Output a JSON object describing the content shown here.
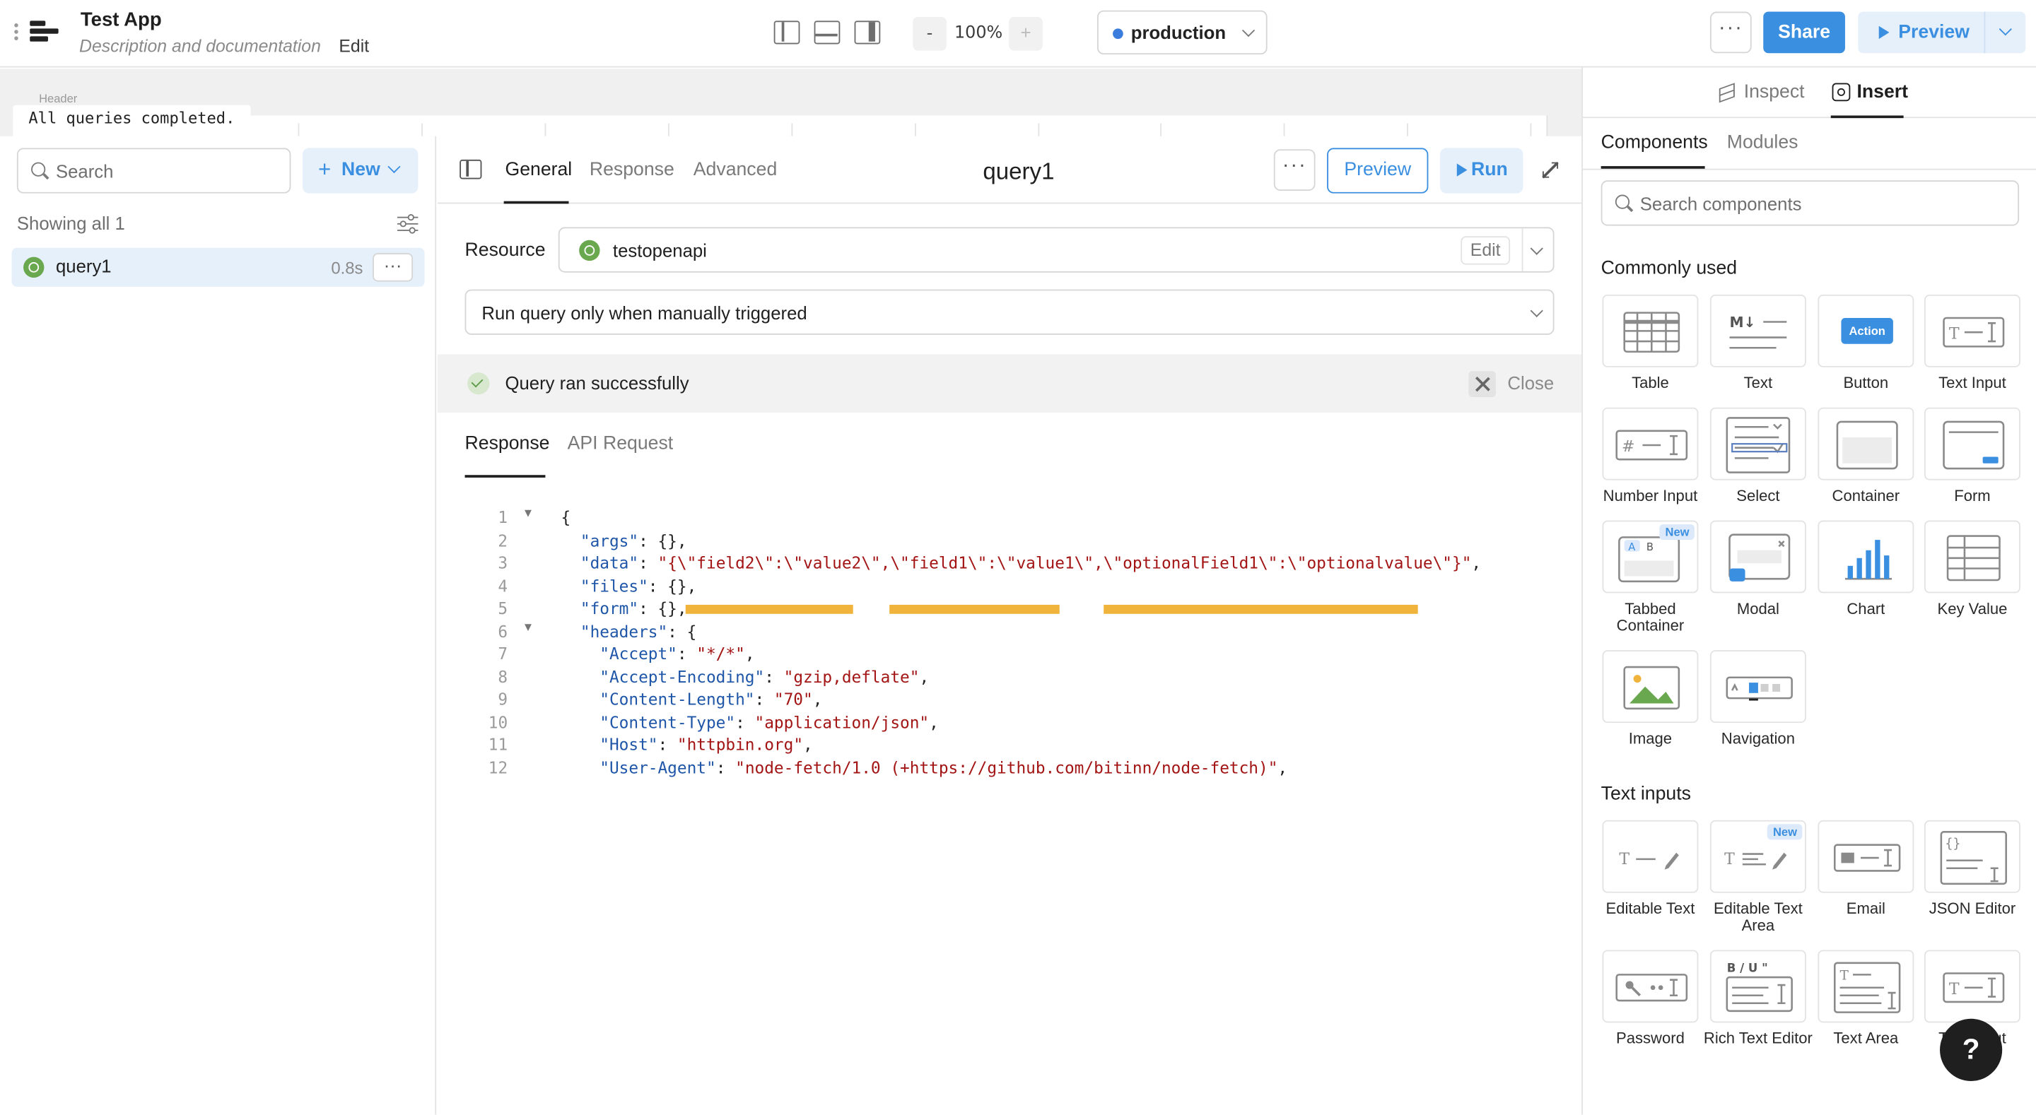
{
  "app": {
    "title": "Test App",
    "description": "Description and documentation",
    "edit_label": "Edit"
  },
  "toolbar": {
    "zoom_minus": "-",
    "zoom": "100%",
    "zoom_plus": "+",
    "environment": "production",
    "more": "···",
    "share": "Share",
    "preview": "Preview"
  },
  "canvas": {
    "header_tag": "Header",
    "toast": "All queries completed."
  },
  "query_list": {
    "search_placeholder": "Search",
    "new_label": "New",
    "showing": "Showing all 1",
    "items": [
      {
        "name": "query1",
        "time": "0.8s",
        "more": "···"
      }
    ]
  },
  "editor": {
    "tabs": [
      "General",
      "Response",
      "Advanced"
    ],
    "active_tab": "General",
    "query_name": "query1",
    "more": "···",
    "preview": "Preview",
    "run": "Run",
    "resource_label": "Resource",
    "resource": "testopenapi",
    "resource_edit": "Edit",
    "trigger": "Run query only when manually triggered",
    "status": "Query ran successfully",
    "close": "Close",
    "response_tabs": [
      "Response",
      "API Request"
    ],
    "active_response_tab": "Response"
  },
  "response_json": [
    {
      "ln": "1",
      "fold": true,
      "parts": [
        [
          "p",
          "{"
        ]
      ]
    },
    {
      "ln": "2",
      "fold": false,
      "parts": [
        [
          "p",
          "  "
        ],
        [
          "k",
          "\"args\""
        ],
        [
          "p",
          ": {},"
        ]
      ]
    },
    {
      "ln": "3",
      "fold": false,
      "parts": [
        [
          "p",
          "  "
        ],
        [
          "k",
          "\"data\""
        ],
        [
          "p",
          ": "
        ],
        [
          "s",
          "\"{\\\"field2\\\":\\\"value2\\\",\\\"field1\\\":\\\"value1\\\",\\\"optionalField1\\\":\\\"optionalvalue\\\"}\""
        ],
        [
          "p",
          ","
        ]
      ]
    },
    {
      "ln": "4",
      "fold": false,
      "parts": [
        [
          "p",
          "  "
        ],
        [
          "k",
          "\"files\""
        ],
        [
          "p",
          ": {},"
        ]
      ]
    },
    {
      "ln": "5",
      "fold": false,
      "parts": [
        [
          "p",
          "  "
        ],
        [
          "k",
          "\"form\""
        ],
        [
          "p",
          ": {},"
        ]
      ]
    },
    {
      "ln": "6",
      "fold": true,
      "parts": [
        [
          "p",
          "  "
        ],
        [
          "k",
          "\"headers\""
        ],
        [
          "p",
          ": {"
        ]
      ]
    },
    {
      "ln": "7",
      "fold": false,
      "parts": [
        [
          "p",
          "    "
        ],
        [
          "k",
          "\"Accept\""
        ],
        [
          "p",
          ": "
        ],
        [
          "s",
          "\"*/*\""
        ],
        [
          "p",
          ","
        ]
      ]
    },
    {
      "ln": "8",
      "fold": false,
      "parts": [
        [
          "p",
          "    "
        ],
        [
          "k",
          "\"Accept-Encoding\""
        ],
        [
          "p",
          ": "
        ],
        [
          "s",
          "\"gzip,deflate\""
        ],
        [
          "p",
          ","
        ]
      ]
    },
    {
      "ln": "9",
      "fold": false,
      "parts": [
        [
          "p",
          "    "
        ],
        [
          "k",
          "\"Content-Length\""
        ],
        [
          "p",
          ": "
        ],
        [
          "s",
          "\"70\""
        ],
        [
          "p",
          ","
        ]
      ]
    },
    {
      "ln": "10",
      "fold": false,
      "parts": [
        [
          "p",
          "    "
        ],
        [
          "k",
          "\"Content-Type\""
        ],
        [
          "p",
          ": "
        ],
        [
          "s",
          "\"application/json\""
        ],
        [
          "p",
          ","
        ]
      ]
    },
    {
      "ln": "11",
      "fold": false,
      "parts": [
        [
          "p",
          "    "
        ],
        [
          "k",
          "\"Host\""
        ],
        [
          "p",
          ": "
        ],
        [
          "s",
          "\"httpbin.org\""
        ],
        [
          "p",
          ","
        ]
      ]
    },
    {
      "ln": "12",
      "fold": false,
      "parts": [
        [
          "p",
          "    "
        ],
        [
          "k",
          "\"User-Agent\""
        ],
        [
          "p",
          ": "
        ],
        [
          "s",
          "\"node-fetch/1.0 (+https://github.com/bitinn/node-fetch)\""
        ],
        [
          "p",
          ","
        ]
      ]
    }
  ],
  "right_panel": {
    "tabs": [
      "Inspect",
      "Insert"
    ],
    "active_tab": "Insert",
    "subtabs": [
      "Components",
      "Modules"
    ],
    "active_subtab": "Components",
    "search_placeholder": "Search components",
    "sections": [
      {
        "title": "Commonly used",
        "components": [
          {
            "label": "Table",
            "icon": "table-icon"
          },
          {
            "label": "Text",
            "icon": "markdown-text-icon"
          },
          {
            "label": "Button",
            "icon": "action-button-icon",
            "badge": "Action"
          },
          {
            "label": "Text Input",
            "icon": "text-input-icon"
          },
          {
            "label": "Number Input",
            "icon": "number-input-icon"
          },
          {
            "label": "Select",
            "icon": "select-icon"
          },
          {
            "label": "Container",
            "icon": "container-icon"
          },
          {
            "label": "Form",
            "icon": "form-icon"
          },
          {
            "label": "Tabbed Container",
            "icon": "tabbed-container-icon",
            "new": "New"
          },
          {
            "label": "Modal",
            "icon": "modal-icon"
          },
          {
            "label": "Chart",
            "icon": "chart-icon"
          },
          {
            "label": "Key Value",
            "icon": "key-value-icon"
          },
          {
            "label": "Image",
            "icon": "image-icon"
          },
          {
            "label": "Navigation",
            "icon": "navigation-icon"
          }
        ]
      },
      {
        "title": "Text inputs",
        "components": [
          {
            "label": "Editable Text",
            "icon": "editable-text-icon"
          },
          {
            "label": "Editable Text Area",
            "icon": "editable-text-area-icon",
            "new": "New"
          },
          {
            "label": "Email",
            "icon": "email-icon"
          },
          {
            "label": "JSON Editor",
            "icon": "json-editor-icon"
          },
          {
            "label": "Password",
            "icon": "password-icon"
          },
          {
            "label": "Rich Text Editor",
            "icon": "rich-text-editor-icon"
          },
          {
            "label": "Text Area",
            "icon": "text-area-icon"
          },
          {
            "label": "Text Input",
            "icon": "text-input-icon"
          }
        ]
      }
    ]
  },
  "help": "?",
  "colors": {
    "accent": "#3b8fe0",
    "accent_light": "#e6f0fb",
    "success": "#5c9a46",
    "highlight": "#f0b43c"
  }
}
